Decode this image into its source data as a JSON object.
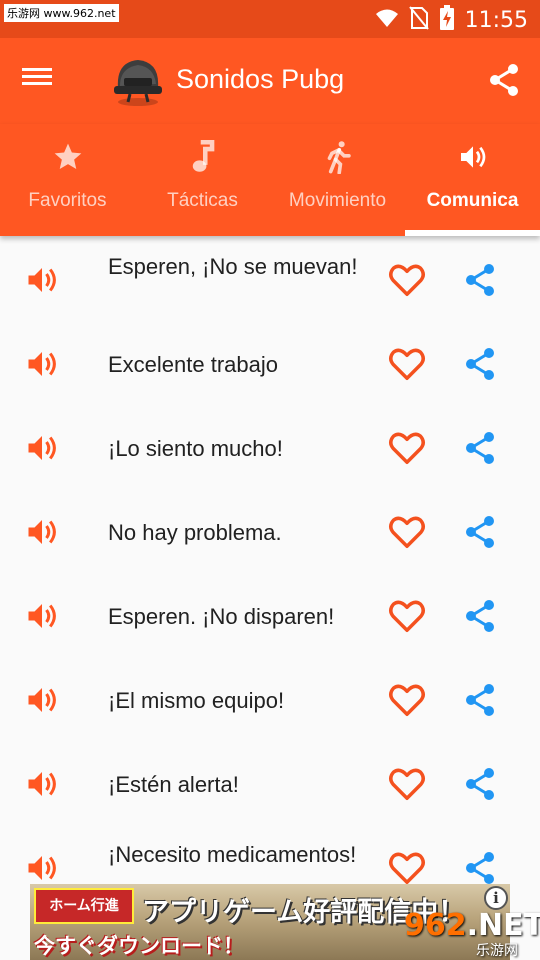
{
  "status_bar": {
    "watermark": "乐游网 www.962.net",
    "time": "11:55",
    "icons": [
      "image-icon",
      "wifi-icon",
      "no-sim-icon",
      "battery-charging-icon"
    ]
  },
  "app_bar": {
    "title": "Sonidos Pubg",
    "icons": [
      "menu-icon",
      "helmet-logo",
      "share-icon"
    ]
  },
  "tabs": [
    {
      "label": "Favoritos",
      "icon": "star-icon",
      "active": false
    },
    {
      "label": "Tácticas",
      "icon": "music-note-icon",
      "active": false
    },
    {
      "label": "Movimiento",
      "icon": "run-icon",
      "active": false
    },
    {
      "label": "Comunica",
      "icon": "speaker-icon",
      "active": true
    }
  ],
  "sounds": [
    {
      "text": "Esperen, ¡No se muevan!"
    },
    {
      "text": "Excelente trabajo"
    },
    {
      "text": "¡Lo siento mucho!"
    },
    {
      "text": "No hay problema."
    },
    {
      "text": "Esperen. ¡No disparen!"
    },
    {
      "text": "¡El mismo equipo!"
    },
    {
      "text": "¡Estén alerta!"
    },
    {
      "text": "¡Necesito medicamentos!"
    }
  ],
  "ad": {
    "badge": "ホーム行進",
    "line1": "アプリゲーム好評配信中！",
    "line2": "今すぐダウンロード！",
    "info": "i"
  },
  "site_logo": {
    "number": "962",
    "net": ".NET",
    "subtitle": "乐游网"
  },
  "colors": {
    "primary": "#ff5722",
    "status": "#e64a19",
    "sound_icon": "#ff5722",
    "favorite": "#f4511e",
    "share": "#2196f3"
  }
}
